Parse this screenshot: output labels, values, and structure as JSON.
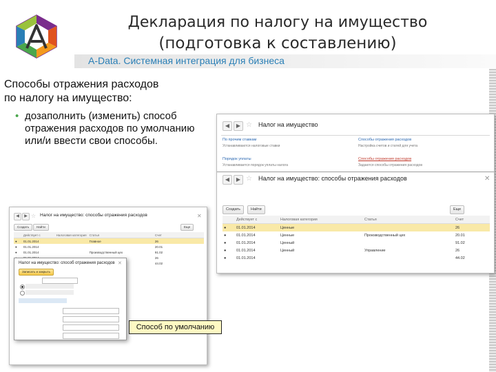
{
  "slide": {
    "title_line1": "Декларация по налогу на имущество",
    "title_line2": "(подготовка к составлению)",
    "subtitle": "A-Data. Системная интеграция для бизнеса",
    "heading_line1": "Способы отражения расходов",
    "heading_line2": "по налогу на имущество:",
    "bullet": "дозаполнить (изменить) способ отражения расходов по умолчанию или/и ввести свои способы.",
    "callout": "Способ по умолчанию"
  },
  "colors": {
    "accent_green": "#4aa64c",
    "subtitle_blue": "#2a7fb6",
    "selection_yellow": "#f9e9a7"
  },
  "right_window": {
    "title": "Налог на имущество",
    "list_title": "Налог на имущество: способы отражения расходов",
    "buttons": {
      "create": "Создать",
      "find": "Найти",
      "more": "Еще"
    },
    "columns": [
      "Действует с",
      "Налоговая категория",
      "Статья",
      "Счет"
    ],
    "rows": [
      [
        "01.01.2014",
        "Ценные",
        "",
        "26"
      ],
      [
        "01.01.2014",
        "Ценные",
        "Производственный цех",
        "20.01"
      ],
      [
        "01.01.2014",
        "Ценный",
        "",
        "91.02"
      ],
      [
        "01.01.2014",
        "Ценный",
        "Управление",
        "26"
      ],
      [
        "01.01.2014",
        "",
        "",
        "44.02"
      ]
    ]
  },
  "left_window": {
    "title": "Налог на имущество: способы отражения расходов",
    "popup_title": "Налог на имущество: способ отражения расходов",
    "popup_button": "Записать и закрыть",
    "rows": [
      [
        "01.01.2014",
        "",
        "Главное",
        "26"
      ],
      [
        "01.01.2014",
        "",
        "",
        "20.01"
      ],
      [
        "01.01.2014",
        "",
        "Производственный цех",
        "91.02"
      ],
      [
        "01.01.2014",
        "",
        "",
        "26"
      ],
      [
        "01.01.2014",
        "",
        "",
        "44.02"
      ]
    ]
  },
  "icons": [
    "logo-icon",
    "back-icon",
    "forward-icon",
    "star-icon",
    "close-icon",
    "bullet-icon"
  ]
}
